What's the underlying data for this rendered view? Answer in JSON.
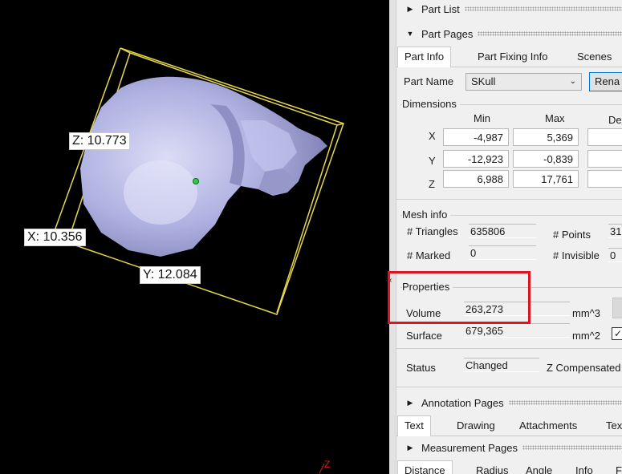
{
  "viewport": {
    "labels": {
      "x": "X: 10.356",
      "y": "Y: 12.084",
      "z": "Z: 10.773"
    },
    "axis_marker": "Z"
  },
  "part_list": {
    "title": "Part List"
  },
  "part_pages": {
    "title": "Part Pages",
    "tabs": [
      "Part Info",
      "Part Fixing Info",
      "Scenes"
    ],
    "part_name_label": "Part Name",
    "part_name_value": "SKull",
    "rename_button": "Rena",
    "dimensions": {
      "title": "Dimensions",
      "headers": [
        "Min",
        "Max",
        "De"
      ],
      "rows": [
        {
          "axis": "X",
          "min": "-4,987",
          "max": "5,369",
          "delta": ""
        },
        {
          "axis": "Y",
          "min": "-12,923",
          "max": "-0,839",
          "delta": ""
        },
        {
          "axis": "Z",
          "min": "6,988",
          "max": "17,761",
          "delta": ""
        }
      ]
    },
    "mesh_info": {
      "title": "Mesh info",
      "triangles_label": "# Triangles",
      "triangles_value": "635806",
      "points_label": "# Points",
      "points_value": "31",
      "marked_label": "# Marked",
      "marked_value": "0",
      "invisible_label": "# Invisible",
      "invisible_value": "0"
    },
    "properties": {
      "title": "Properties",
      "volume_label": "Volume",
      "volume_value": "263,273",
      "volume_unit": "mm^3",
      "surface_label": "Surface",
      "surface_value": "679,365",
      "surface_unit": "mm^2"
    },
    "status": {
      "label": "Status",
      "value": "Changed",
      "z_comp": "Z Compensated"
    }
  },
  "annotation_pages": {
    "title": "Annotation Pages",
    "tabs": [
      "Text",
      "Drawing",
      "Attachments",
      "Textu"
    ]
  },
  "measurement_pages": {
    "title": "Measurement Pages",
    "tabs": [
      "Distance",
      "Radius",
      "Angle",
      "Info",
      "F"
    ]
  },
  "colors": {
    "bounding_box": "#e6d84a",
    "skull": "#b4b6e8",
    "highlight": "#e0141e",
    "center_dot": "#2ecc40"
  }
}
